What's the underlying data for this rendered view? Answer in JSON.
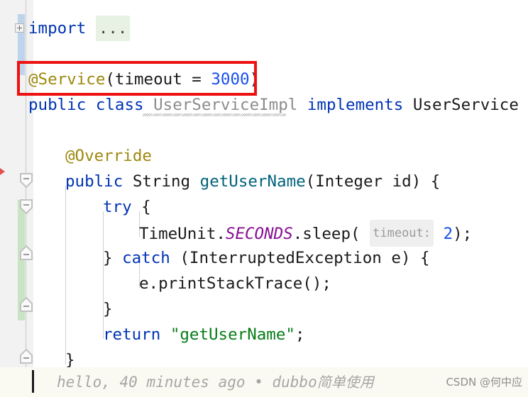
{
  "editor": {
    "language": "java",
    "font_size_px": 22.5,
    "line_height_px": 36,
    "background": "#ffffff",
    "gutter_background": "#f2f2f2"
  },
  "colors": {
    "keyword": "#0033b3",
    "annotation": "#9e880d",
    "number": "#1750eb",
    "string": "#067d17",
    "method": "#00627a",
    "static_field": "#871094",
    "class_ref": "#8c8c8c",
    "highlight_box": "#ee1111",
    "vcs_added": "#c9e4c4",
    "vcs_changed": "#bed3ec",
    "blame_background": "#fbfaf2",
    "fold_chip_background": "#e8f2e4",
    "param_hint_background": "#efefef"
  },
  "code": {
    "lines": [
      {
        "text": "import ...",
        "tokens": [
          "import",
          "..."
        ]
      },
      {
        "text": ""
      },
      {
        "text": "@Service(timeout = 3000)"
      },
      {
        "text": "public class UserServiceImpl implements UserService {"
      },
      {
        "text": ""
      },
      {
        "text": "    @Override"
      },
      {
        "text": "    public String getUserName(Integer id) {"
      },
      {
        "text": "        try {"
      },
      {
        "text": "            TimeUnit.SECONDS.sleep( timeout: 2);"
      },
      {
        "text": "        } catch (InterruptedException e) {"
      },
      {
        "text": "            e.printStackTrace();"
      },
      {
        "text": "        }"
      },
      {
        "text": "        return \"getUserName\";"
      },
      {
        "text": "    }"
      }
    ],
    "tokens": {
      "import_kw": "import",
      "fold_ellipsis": "...",
      "annotation_service": "@Service",
      "paren_open": "(",
      "attr_timeout": "timeout",
      "equals": " = ",
      "value_3000": "3000",
      "paren_close": ")",
      "kw_public": "public",
      "kw_class": "class",
      "class_name": "UserServiceImpl",
      "kw_implements": "implements",
      "interface_name": "UserService",
      "brace_open": " {",
      "annotation_override": "@Override",
      "type_String": "String",
      "method_getUserName": "getUserName",
      "param_type_Integer": "Integer",
      "param_name_id": "id",
      "kw_try": "try",
      "cls_TimeUnit": "TimeUnit",
      "field_SECONDS": "SECONDS",
      "method_sleep": "sleep",
      "hint_timeout": "timeout:",
      "arg_2": "2",
      "kw_catch": "catch",
      "exc_InterruptedException": "InterruptedException",
      "exc_var_e": "e",
      "expr_printStackTrace": "e.printStackTrace();",
      "kw_return": "return",
      "str_getUserName": "\"getUserName\"",
      "semicolon": ";",
      "brace_close": "}"
    }
  },
  "gutter": {
    "expand_import_icon": "plus-box-icon",
    "fold_markers": [
      {
        "name": "fold-collapse-method",
        "direction": "down"
      },
      {
        "name": "fold-collapse-try",
        "direction": "down"
      },
      {
        "name": "fold-expand-catch",
        "direction": "up"
      },
      {
        "name": "fold-expand-block",
        "direction": "up"
      },
      {
        "name": "fold-expand-method-end",
        "direction": "up"
      }
    ],
    "error_marker": "error-tick-icon"
  },
  "annotation": {
    "highlight_label": "red-rectangle-highlight",
    "target_line": "@Service(timeout = 3000)"
  },
  "blame": {
    "author": "hello,",
    "time": "40 minutes ago",
    "separator": "•",
    "message_latin": "dubbo",
    "message_cjk": "简单使用",
    "full": "hello, 40 minutes ago • dubbo简单使用"
  },
  "watermark": {
    "text": "CSDN @何中应"
  }
}
